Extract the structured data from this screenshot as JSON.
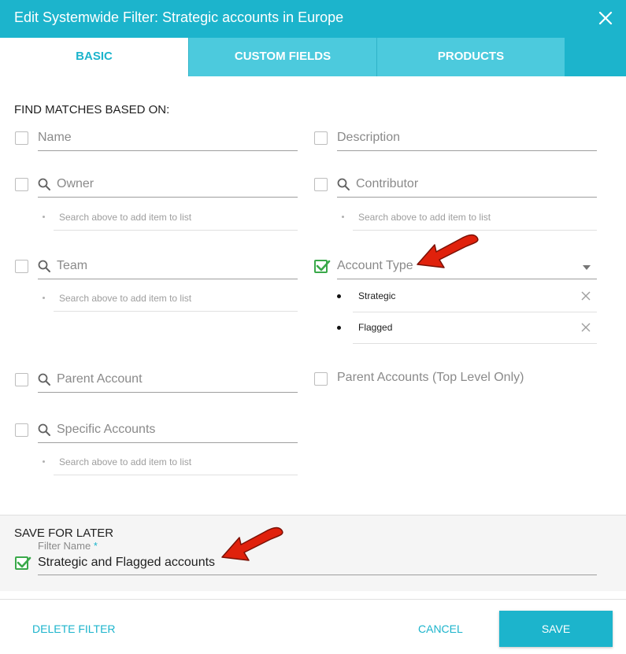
{
  "header": {
    "title": "Edit Systemwide Filter: Strategic accounts in Europe",
    "close_icon": "close-icon"
  },
  "tabs": [
    {
      "label": "BASIC",
      "active": true
    },
    {
      "label": "CUSTOM FIELDS",
      "active": false
    },
    {
      "label": "PRODUCTS",
      "active": false
    }
  ],
  "find_matches": {
    "title": "FIND MATCHES BASED ON:",
    "fields": {
      "name": {
        "label": "Name",
        "checked": false
      },
      "description": {
        "label": "Description",
        "checked": false
      },
      "owner": {
        "label": "Owner",
        "checked": false,
        "hint": "Search above to add item to list"
      },
      "contributor": {
        "label": "Contributor",
        "checked": false,
        "hint": "Search above to add item to list"
      },
      "team": {
        "label": "Team",
        "checked": false,
        "hint": "Search above to add item to list"
      },
      "account_type": {
        "label": "Account Type",
        "checked": true,
        "items": [
          "Strategic",
          "Flagged"
        ]
      },
      "parent_account": {
        "label": "Parent Account",
        "checked": false
      },
      "parent_accounts_top": {
        "label": "Parent Accounts (Top Level Only)",
        "checked": false
      },
      "specific_accounts": {
        "label": "Specific Accounts",
        "checked": false,
        "hint": "Search above to add item to list"
      }
    }
  },
  "save_for_later": {
    "title": "SAVE FOR LATER",
    "filter_name_label": "Filter Name",
    "required_mark": "*",
    "filter_name_value": "Strategic and Flagged accounts",
    "checked": true
  },
  "footer": {
    "delete_label": "DELETE FILTER",
    "cancel_label": "CANCEL",
    "save_label": "SAVE"
  },
  "colors": {
    "primary": "#1cb4cc",
    "tab_inactive": "#4ccadd",
    "check_green": "#3aa94a",
    "annotation_red": "#e0210c"
  }
}
